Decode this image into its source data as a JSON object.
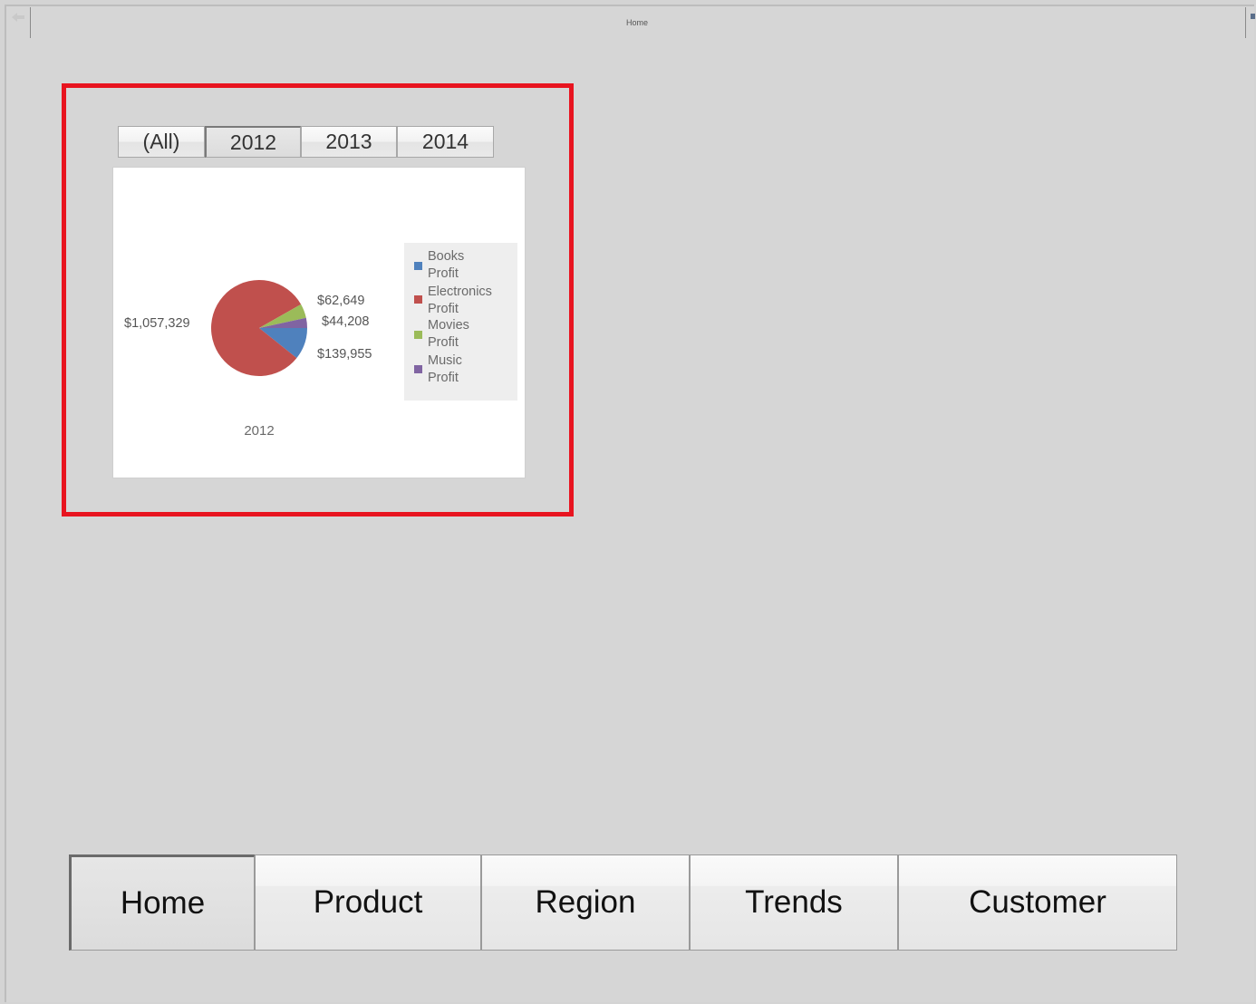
{
  "window": {
    "title": "Home"
  },
  "slicer": {
    "items": [
      {
        "label": "(All)",
        "selected": false
      },
      {
        "label": "2012",
        "selected": true
      },
      {
        "label": "2013",
        "selected": false
      },
      {
        "label": "2014",
        "selected": false
      }
    ]
  },
  "chart_data": {
    "type": "pie",
    "categories": [
      "Books Profit",
      "Electronics Profit",
      "Movies Profit",
      "Music Profit"
    ],
    "values": [
      139955,
      1057329,
      62649,
      44208
    ],
    "value_labels": [
      "$139,955",
      "$1,057,329",
      "$62,649",
      "$44,208"
    ],
    "colors": [
      "#4f81bd",
      "#c0504d",
      "#9bbb59",
      "#8064a2"
    ],
    "xlabel": "2012",
    "legend": {
      "position": "right",
      "items": [
        {
          "line1": "Books",
          "line2": "Profit"
        },
        {
          "line1": "Electronics",
          "line2": "Profit"
        },
        {
          "line1": "Movies",
          "line2": "Profit"
        },
        {
          "line1": "Music",
          "line2": "Profit"
        }
      ]
    }
  },
  "tabs": [
    {
      "label": "Home",
      "active": true
    },
    {
      "label": "Product",
      "active": false
    },
    {
      "label": "Region",
      "active": false
    },
    {
      "label": "Trends",
      "active": false
    },
    {
      "label": "Customer",
      "active": false
    }
  ],
  "highlight_color": "#e8141f"
}
